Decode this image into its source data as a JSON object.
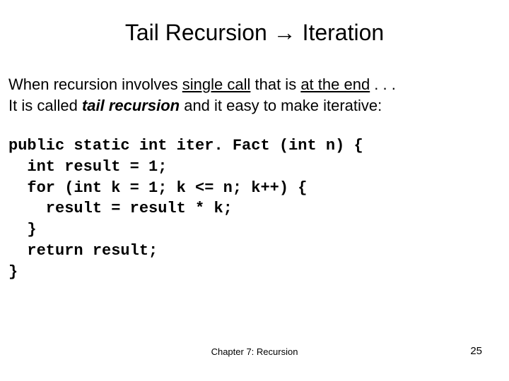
{
  "title": "Tail Recursion → Iteration",
  "para": {
    "p1a": "When recursion involves ",
    "p1b": "single call",
    "p1c": " that is ",
    "p1d": "at the end",
    "p1e": " . . .",
    "p2a": "It is called ",
    "p2b": "tail recursion",
    "p2c": " and it easy to make iterative:"
  },
  "code": {
    "l1": "public static int iter. Fact (int n) {",
    "l2": "  int result = 1;",
    "l3": "  for (int k = 1; k <= n; k++) {",
    "l4": "    result = result * k;",
    "l5": "  }",
    "l6": "  return result;",
    "l7": "}"
  },
  "footer": "Chapter 7: Recursion",
  "page_number": "25"
}
